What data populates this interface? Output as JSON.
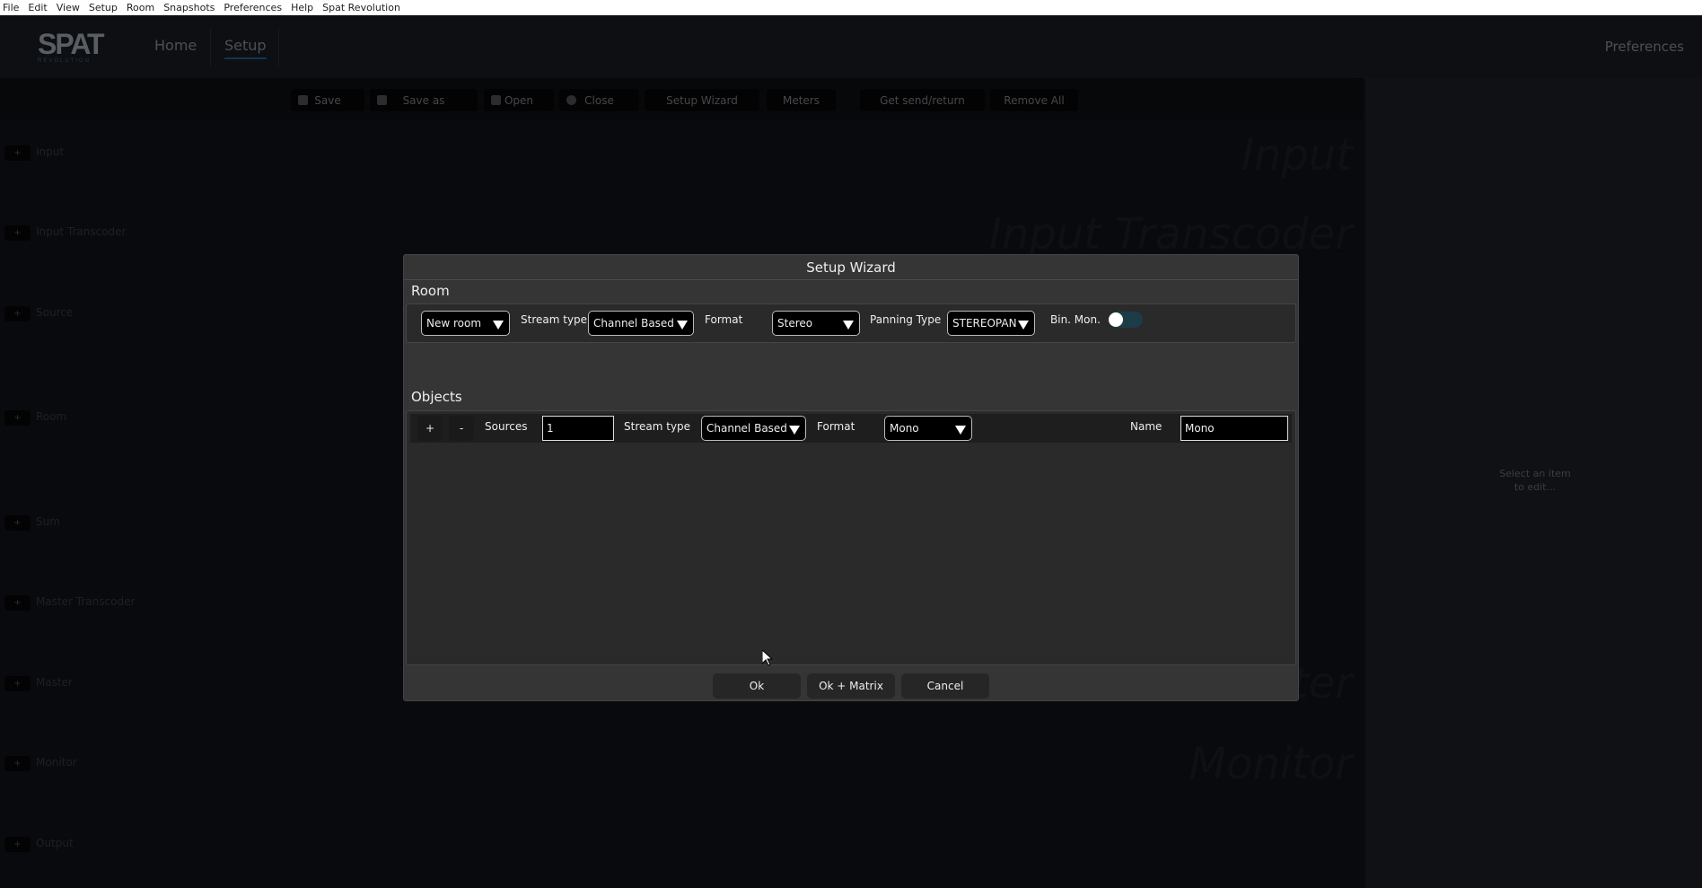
{
  "menubar": [
    "File",
    "Edit",
    "View",
    "Setup",
    "Room",
    "Snapshots",
    "Preferences",
    "Help",
    "Spat Revolution"
  ],
  "header": {
    "logo": "SPAT",
    "logo_sub": "REVOLUTION",
    "home": "Home",
    "setup": "Setup",
    "preferences": "Preferences"
  },
  "toolbar": {
    "save": "Save",
    "save_as": "Save as",
    "open": "Open",
    "close": "Close",
    "setup_wizard": "Setup Wizard",
    "meters": "Meters",
    "get_send_return": "Get send/return",
    "remove_all": "Remove All"
  },
  "sections": [
    "Input",
    "Input Transcoder",
    "Source",
    "Room",
    "Sum",
    "Master Transcoder",
    "Master",
    "Monitor",
    "Output"
  ],
  "add_label": "+",
  "watermarks": {
    "input": "Input",
    "input_transcoder": "Input Transcoder",
    "master": "Master",
    "monitor": "Monitor"
  },
  "right_panel": {
    "line1": "Select an item",
    "line2": "to edit..."
  },
  "dialog": {
    "title": "Setup Wizard",
    "room": {
      "heading": "Room",
      "room_select": "New room",
      "stream_type_label": "Stream type",
      "stream_type": "Channel Based",
      "format_label": "Format",
      "format": "Stereo",
      "panning_label": "Panning Type",
      "panning": "STEREOPAN",
      "bin_mon_label": "Bin. Mon.",
      "bin_mon_on": false
    },
    "objects": {
      "heading": "Objects",
      "add": "+",
      "remove": "-",
      "sources_label": "Sources",
      "sources": "1",
      "stream_type_label": "Stream type",
      "stream_type": "Channel Based",
      "format_label": "Format",
      "format": "Mono",
      "name_label": "Name",
      "name": "Mono"
    },
    "ok": "Ok",
    "ok_matrix": "Ok + Matrix",
    "cancel": "Cancel"
  }
}
